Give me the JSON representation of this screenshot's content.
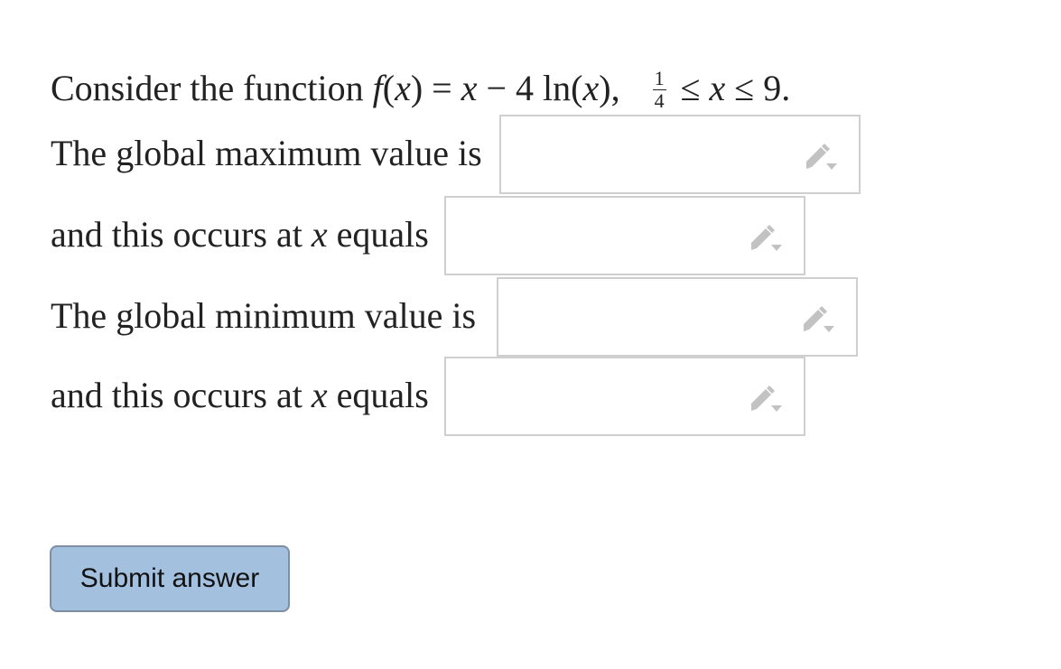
{
  "problem": {
    "intro": "Consider the function ",
    "func_name": "f",
    "func_lparen": "(",
    "func_var": "x",
    "func_rparen": ")",
    "equals": " = ",
    "rhs_var": "x",
    "rhs_rest": " − 4 ln(",
    "rhs_var2": "x",
    "rhs_close": "),",
    "domain_num": "1",
    "domain_den": "4",
    "domain_op1": " ≤ ",
    "domain_var": "x",
    "domain_op2": " ≤ 9."
  },
  "questions": [
    {
      "label": "The global maximum value is",
      "value": ""
    },
    {
      "label_pre": "and this occurs at ",
      "label_var": "x",
      "label_post": " equals",
      "value": ""
    },
    {
      "label": "The global minimum value is",
      "value": ""
    },
    {
      "label_pre": "and this occurs at ",
      "label_var": "x",
      "label_post": " equals",
      "value": ""
    }
  ],
  "icons": {
    "answer_tool": "pencil-dropdown-icon"
  },
  "colors": {
    "submit_bg": "#a3c0df",
    "submit_border": "#7f8fa2",
    "box_border": "#cfcfcf",
    "icon_gray": "#c2c2c2"
  },
  "submit": {
    "label": "Submit answer"
  }
}
